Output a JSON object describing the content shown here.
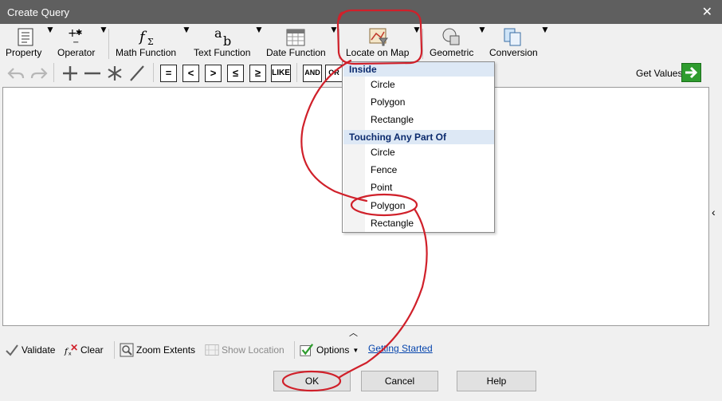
{
  "window": {
    "title": "Create Query",
    "close_icon": "close-icon"
  },
  "ribbon": [
    {
      "key": "property",
      "label": "Property",
      "icon": "property-icon"
    },
    {
      "key": "operator",
      "label": "Operator",
      "icon": "operator-icon"
    },
    {
      "key": "math",
      "label": "Math Function",
      "icon": "math-function-icon"
    },
    {
      "key": "text",
      "label": "Text Function",
      "icon": "text-function-icon"
    },
    {
      "key": "date",
      "label": "Date Function",
      "icon": "calendar-icon"
    },
    {
      "key": "locate",
      "label": "Locate on Map",
      "icon": "map-icon"
    },
    {
      "key": "geometric",
      "label": "Geometric",
      "icon": "geometric-icon"
    },
    {
      "key": "conversion",
      "label": "Conversion",
      "icon": "conversion-icon"
    }
  ],
  "toolbar": {
    "operators": [
      "=",
      "<",
      ">",
      "≤",
      "≥",
      "LIKE",
      "AND",
      "OR"
    ],
    "get_values_label": "Get Values"
  },
  "menu": {
    "inside_header": "Inside",
    "inside_items": [
      "Circle",
      "Polygon",
      "Rectangle"
    ],
    "touching_header": "Touching Any Part Of",
    "touching_items": [
      "Circle",
      "Fence",
      "Point",
      "Polygon",
      "Rectangle"
    ]
  },
  "bottom": {
    "validate": "Validate",
    "clear": "Clear",
    "zoom_extents": "Zoom Extents",
    "show_location": "Show Location",
    "options": "Options",
    "getting_started": "Getting Started"
  },
  "buttons": {
    "ok": "OK",
    "cancel": "Cancel",
    "help": "Help"
  },
  "annotation_color": "#d0202a"
}
